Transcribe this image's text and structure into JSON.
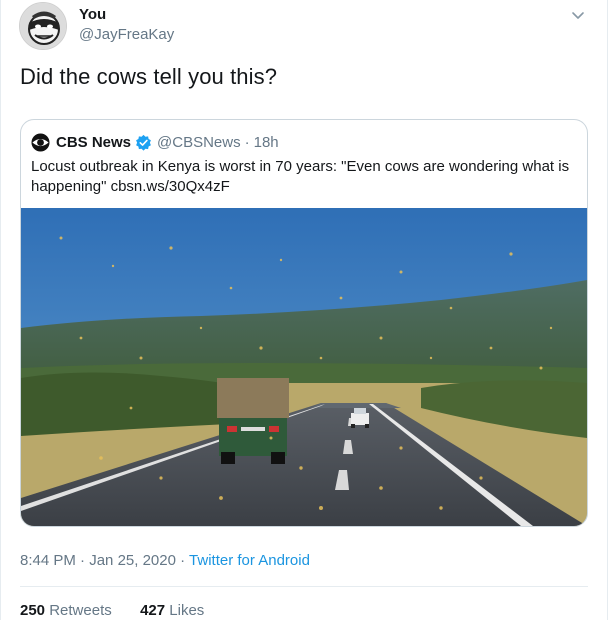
{
  "author": {
    "name": "You",
    "handle": "@JayFreaKay",
    "avatar_icon": "masked-character-avatar"
  },
  "tweet": {
    "text": "Did the cows tell you this?",
    "caret_icon": "chevron-down-icon"
  },
  "quoted_tweet": {
    "name": "CBS News",
    "verified": true,
    "handle": "@CBSNews",
    "separator": "·",
    "time": "18h",
    "text": "Locust outbreak in Kenya is worst in 70 years: \"Even cows are wondering what is happening\" cbsn.ws/30Qx4zF",
    "image_description_icon": "locust-swarm-road-photo"
  },
  "meta": {
    "time": "8:44 PM",
    "separator1": "·",
    "date": "Jan 25, 2020",
    "separator2": "·",
    "source": "Twitter for Android"
  },
  "stats": {
    "retweets_count": "250",
    "retweets_label": "Retweets",
    "likes_count": "427",
    "likes_label": "Likes"
  },
  "colors": {
    "accent": "#1b95e0",
    "verified": "#1da1f2",
    "text": "#14171a",
    "secondary": "#657786",
    "border": "#ccd6dd"
  }
}
